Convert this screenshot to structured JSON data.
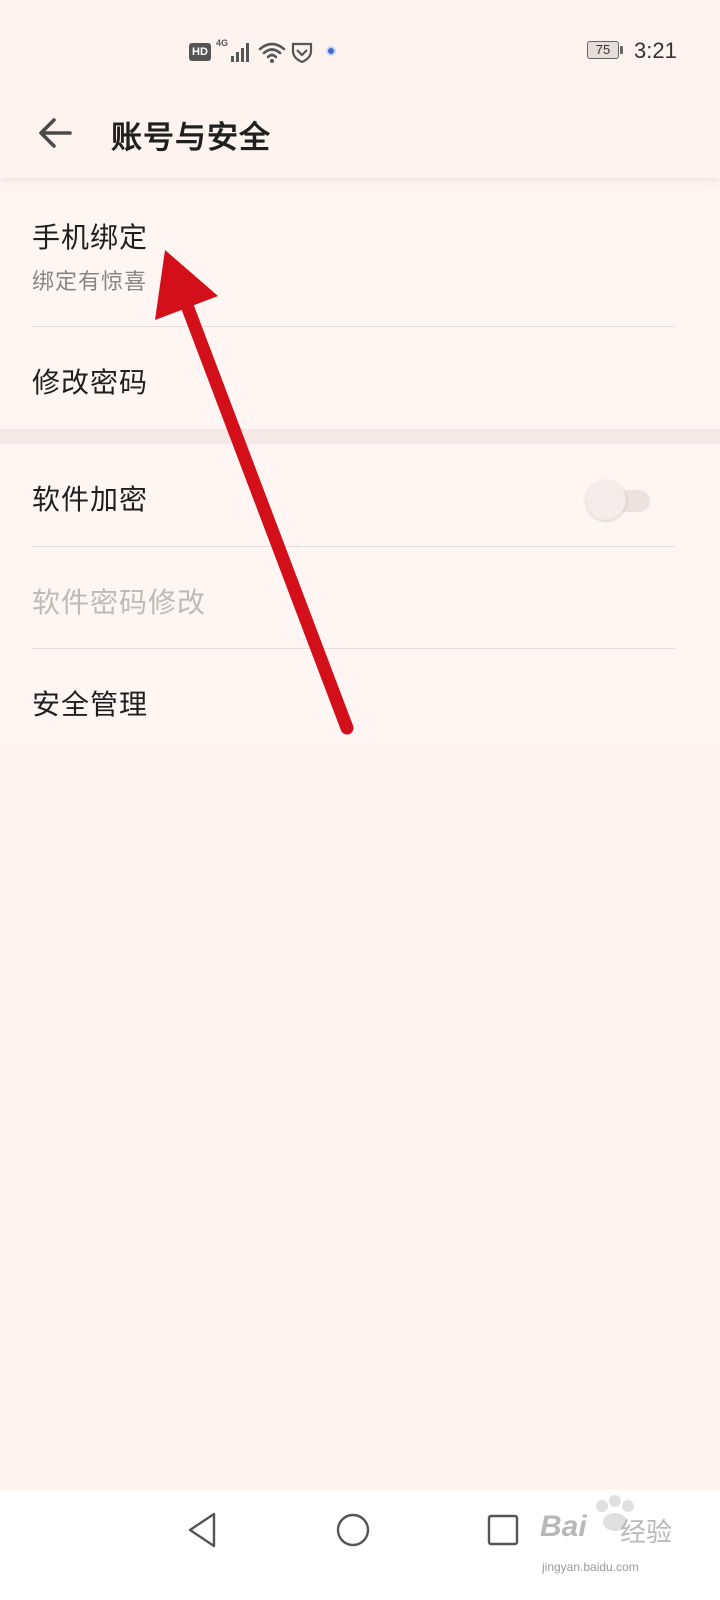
{
  "status_bar": {
    "hd_label": "HD",
    "network_type": "4G",
    "battery_level": "75",
    "time": "3:21",
    "icons": [
      "signal-icon",
      "wifi-icon",
      "shield-icon",
      "location-dot-icon"
    ]
  },
  "header": {
    "title": "账号与安全",
    "back_icon": "arrow-left-icon"
  },
  "sections": [
    {
      "items": [
        {
          "title": "手机绑定",
          "subtitle": "绑定有惊喜"
        },
        {
          "title": "修改密码"
        }
      ]
    },
    {
      "items": [
        {
          "title": "软件加密",
          "toggle_on": false
        },
        {
          "title": "软件密码修改",
          "disabled": true
        },
        {
          "title": "安全管理"
        }
      ]
    }
  ],
  "annotation": {
    "color": "#d3101a",
    "icon": "red-arrow-annotation"
  },
  "nav_bar": {
    "icons": [
      "back-triangle-icon",
      "home-circle-icon",
      "recents-square-icon"
    ]
  },
  "watermark": {
    "brand": "Bai",
    "brand2": "经验",
    "url": "jingyan.baidu.com"
  },
  "colors": {
    "background": "#fff3f0",
    "card": "#fff5f3",
    "text": "#1f1f1f",
    "subtext": "#8a8482",
    "disabled": "#c0b9b7"
  }
}
